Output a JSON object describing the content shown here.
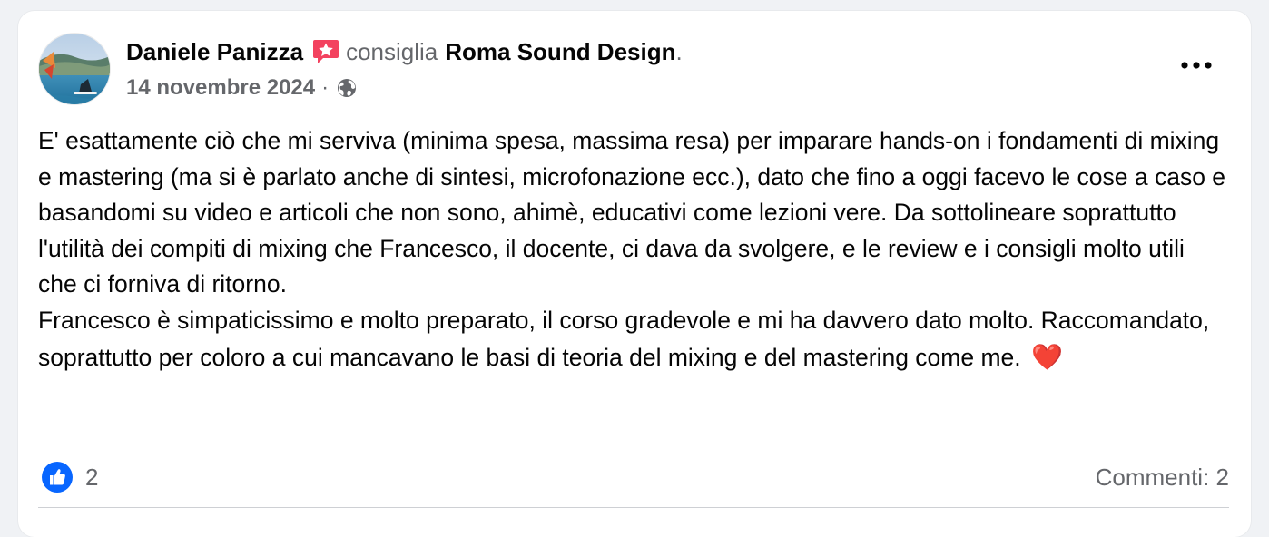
{
  "post": {
    "author": "Daniele Panizza",
    "verb": "consiglia",
    "page": "Roma Sound Design",
    "period": ".",
    "date": "14 novembre 2024",
    "meta_separator": "·",
    "body": "E' esattamente ciò che mi serviva (minima spesa, massima resa) per imparare hands-on i fondamenti di mixing e mastering (ma si è parlato anche di sintesi, microfonazione ecc.), dato che fino a oggi facevo le cose a caso e basandomi su video e articoli che non sono, ahimè, educativi come lezioni vere. Da sottolineare soprattutto l'utilità dei compiti di mixing che Francesco, il docente, ci dava da svolgere, e le review e i consigli molto utili che ci forniva di ritorno.\nFrancesco è simpaticissimo e molto preparato, il corso gradevole e mi ha davvero dato molto. Raccomandato, soprattutto per coloro a cui mancavano le basi di teoria del mixing e del mastering come me.",
    "emoji": "❤️",
    "like_count": "2",
    "comments_label": "Commenti: 2"
  },
  "icons": {
    "badge": "recommend-star-icon",
    "privacy": "globe-icon",
    "menu": "more-options-icon",
    "reaction": "like-thumb-icon"
  },
  "colors": {
    "text": "#050505",
    "secondary": "#65676b",
    "like_blue": "#0866ff",
    "badge_pink": "#f3425f",
    "heart_red": "#e0245e"
  }
}
